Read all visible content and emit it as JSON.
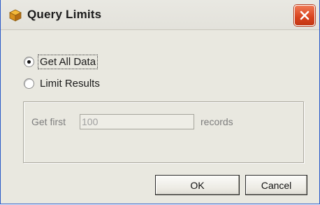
{
  "window": {
    "title": "Query Limits",
    "icon": "box-icon"
  },
  "options": [
    {
      "label": "Get All Data",
      "selected": true
    },
    {
      "label": "Limit Results",
      "selected": false
    }
  ],
  "limit_group": {
    "prefix_label": "Get first",
    "records_value": "100",
    "suffix_label": "records",
    "enabled": false
  },
  "buttons": {
    "ok_label": "OK",
    "cancel_label": "Cancel"
  },
  "colors": {
    "close_button": "#d8431e",
    "dialog_background": "#e9e8e0"
  }
}
